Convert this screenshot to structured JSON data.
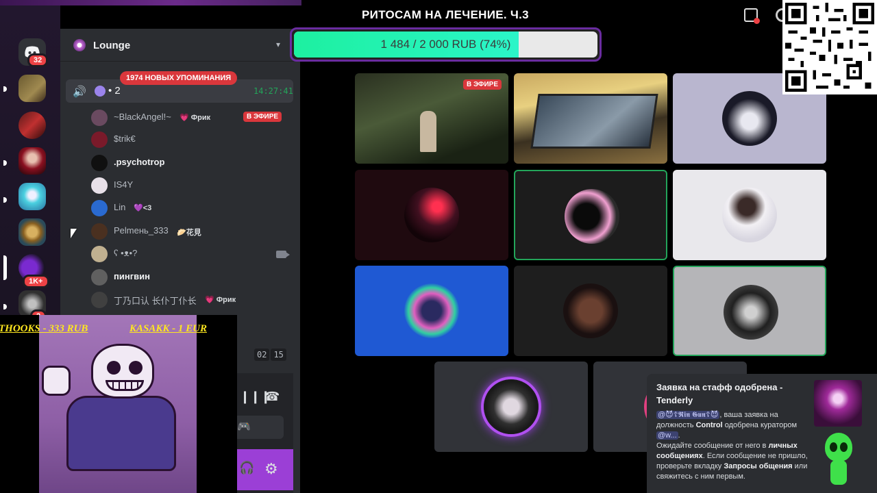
{
  "stream": {
    "title": "РИТОСАМ НА ЛЕЧЕНИЕ. Ч.3",
    "goal_label": "1 484 / 2 000 RUB (74%)",
    "goal_fraction": 0.74
  },
  "rail": {
    "home_badge": "32",
    "server_badges": [
      "1K+",
      "2"
    ]
  },
  "server": {
    "name": "Lounge"
  },
  "voice": {
    "mentions_pill": "1974 НОВЫХ УПОМИНАНИЯ",
    "count": "• 2",
    "time": "14:27:41",
    "live_label": "В ЭФИРЕ",
    "members": [
      {
        "name": "~BlackAngel!~",
        "tag": "💗 Фрик",
        "color": "#6a4a60"
      },
      {
        "name": "$trik€",
        "tag": "",
        "color": "#7a1a2a"
      },
      {
        "name": ".psychotrop",
        "tag": "",
        "color": "#101010"
      },
      {
        "name": "IS4Y",
        "tag": "",
        "color": "#e8e0e8"
      },
      {
        "name": "Lin",
        "tag": "💜<3",
        "color": "#2a6ad0"
      },
      {
        "name": "Pelmeнь_333",
        "tag": "🥟花見",
        "color": "#4a3020"
      },
      {
        "name": "ʕ •ᴥ•?",
        "tag": "",
        "color": "#c0b090"
      },
      {
        "name": "пингвин",
        "tag": "",
        "color": "#606060"
      },
      {
        "name": "丁乃口认 长仆丁仆长",
        "tag": "💗 Фрик",
        "color": "#404040"
      }
    ],
    "timer": [
      "02",
      "15"
    ]
  },
  "donations": {
    "left": "THOOKS - 333 RUB",
    "right": "KASAKK - 1 EUR"
  },
  "grid": {
    "live_label": "В ЭФИРЕ"
  },
  "toast": {
    "title": "Заявка на стафф одобрена - Tenderly",
    "mention_user": "@😈☦𝕽𝖎𝖓 𝕲𝖚𝖓☦😈",
    "text_1": ", ваша заявка на должность ",
    "role": "Control",
    "text_2": " одобрена куратором ",
    "mention_curator": "@w...",
    "text_3": ".",
    "text_4": "Ожидайте сообщение от него в ",
    "dm_bold": "личных сообщениях",
    "text_5": ". Если сообщение не пришло, проверьте вкладку ",
    "req_bold": "Запросы общения",
    "text_6": " или свяжитесь с ним первым."
  },
  "colors": {
    "speaking": "#23a55a",
    "live": "#da373c",
    "goal_fill": "#1df0a0",
    "accent": "#9b3fd6"
  },
  "icons": [
    "discord-icon",
    "speaker-icon",
    "chevron-down-icon",
    "camera-icon",
    "soundboard-icon",
    "hangup-icon",
    "gamepad-icon",
    "headphones-icon",
    "gear-icon"
  ]
}
